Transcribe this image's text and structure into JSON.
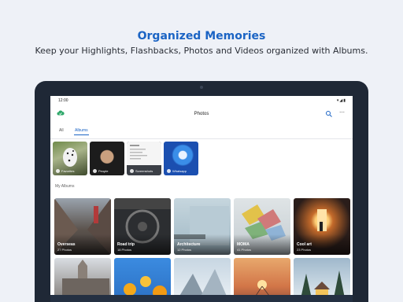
{
  "hero": {
    "title": "Organized Memories",
    "subtitle": "Keep your Highlights, Flashbacks, Photos and Videos organized with Albums."
  },
  "status": {
    "time": "12:00"
  },
  "appbar": {
    "title": "Photos",
    "search_icon": "search-icon",
    "more_icon": "more-vert-icon"
  },
  "tabs": [
    {
      "label": "All"
    },
    {
      "label": "Albums"
    }
  ],
  "quick_albums": [
    {
      "label": "Favorites",
      "icon": "heart-icon"
    },
    {
      "label": "People",
      "icon": "person-icon"
    },
    {
      "label": "Screenshots",
      "icon": "screenshot-icon"
    },
    {
      "label": "Whatsapp",
      "icon": "whatsapp-icon"
    }
  ],
  "section": {
    "my_albums": "My Albums"
  },
  "albums": [
    {
      "name": "Overseas",
      "count": "27 Photos"
    },
    {
      "name": "Road trip",
      "count": "18 Photos"
    },
    {
      "name": "Architecture",
      "count": "12 Photos"
    },
    {
      "name": "MOMA",
      "count": "41 Photos"
    },
    {
      "name": "Cool art",
      "count": "23 Photos"
    }
  ],
  "colors": {
    "accent": "#1b64c4",
    "tablet": "#1f2836"
  }
}
